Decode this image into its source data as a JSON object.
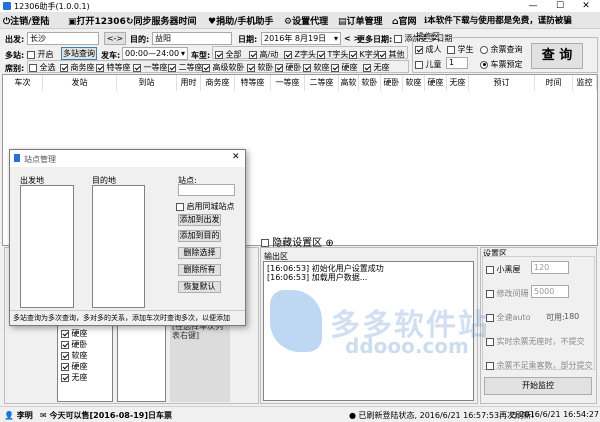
{
  "title": "12306助手(1.0.0.1)",
  "window_controls": {
    "minimize": "—",
    "maximize": "☐",
    "close": "✕"
  },
  "menu": [
    "注销/登陆",
    "打开12306",
    "同步服务器时间",
    "捐助/手机助手",
    "设置代理",
    "订单管理",
    "官网",
    "本软件下载与使用都是免费，谨防被骗"
  ],
  "query": {
    "from_label": "出发:",
    "from_value": "长沙",
    "swap_label": "<->",
    "to_label": "目的:",
    "to_value": "益阳",
    "date_label": "日期:",
    "date_value": "2016年 8月19日",
    "more_dates_label": "更多日期:",
    "add_more_dates": "添加更多日期",
    "multi_label": "多站:",
    "enable_label": "开启",
    "multi_query_btn": "多站查询",
    "depart_label": "发车:",
    "depart_value": "00:00—24:00",
    "train_type_label": "车型:",
    "train_types": [
      {
        "label": "全部",
        "on": true
      },
      {
        "label": "高/动",
        "on": true
      },
      {
        "label": "Z字头",
        "on": true
      },
      {
        "label": "T字头",
        "on": true
      },
      {
        "label": "K字头",
        "on": true
      },
      {
        "label": "其他",
        "on": true
      }
    ],
    "seat_label": "席别:",
    "seats": [
      {
        "label": "全选",
        "on": false
      },
      {
        "label": "商务座",
        "on": true
      },
      {
        "label": "特等座",
        "on": true
      },
      {
        "label": "一等座",
        "on": true
      },
      {
        "label": "二等座",
        "on": true
      },
      {
        "label": "高级软卧",
        "on": true
      },
      {
        "label": "软卧",
        "on": true
      },
      {
        "label": "硬卧",
        "on": true
      },
      {
        "label": "软座",
        "on": true
      },
      {
        "label": "硬座",
        "on": true
      },
      {
        "label": "无座",
        "on": true
      }
    ]
  },
  "op": {
    "title": "操作区",
    "adult": "成人",
    "student": "学生",
    "remain_query": "余票查询",
    "child": "儿童",
    "child_count": "1",
    "ticket_reserve": "车票预定",
    "query_btn": "查 询"
  },
  "grid_headers": [
    "车次",
    "发站",
    "到站",
    "用时",
    "商务座",
    "特等座",
    "一等座",
    "二等座",
    "高软",
    "软卧",
    "硬卧",
    "软座",
    "硬座",
    "无座",
    "预订",
    "时间",
    "监控"
  ],
  "hidden_settings": "隐藏设置区",
  "output": {
    "label": "输出区",
    "lines": [
      "[16:06:53] 初始化用户设置成功",
      "[16:06:53] 加载用户数据..."
    ]
  },
  "settings": {
    "title": "设置区",
    "blacklist": "小黑屋",
    "blacklist_val": "120",
    "modify_interval": "修改间隔",
    "interval_val": "5000",
    "fullauto": "全速auto",
    "available_label": "可用:",
    "available_val": "180",
    "realtime_nofail": "实时余票无座时，不提交",
    "remain_insufficient": "余票不足乘客数，部分提交",
    "start_btn": "开始监控"
  },
  "bottom_seats": [
    {
      "label": "硬座",
      "on": true
    },
    {
      "label": "硬卧",
      "on": true
    },
    {
      "label": "软座",
      "on": true
    },
    {
      "label": "硬座",
      "on": true
    },
    {
      "label": "无座",
      "on": true
    }
  ],
  "bottom_hint": "[在选择车次列表右键]",
  "dialog": {
    "title": "站点管理",
    "from_label": "出发地",
    "to_label": "目的地",
    "station_label": "站点:",
    "same_city": "启用同城站点",
    "add_from": "添加到出发",
    "add_to": "添加到目的",
    "delete_sel": "删除选择",
    "delete_all": "删除所有",
    "restore": "恢复默认",
    "footer": "多站查询为多次查询，多对多的关系，添加车次时查询多次，以便添加"
  },
  "status": {
    "user": "李明",
    "notice": "今天可以售[2016-08-19]日车票",
    "refresh": "已刷新登陆状态, 2016/6/21 16:57:53再次刷新!",
    "time": "2016/6/21 16:54:27"
  },
  "watermark": "多多软件站",
  "watermark_sub": "ddooo.com"
}
